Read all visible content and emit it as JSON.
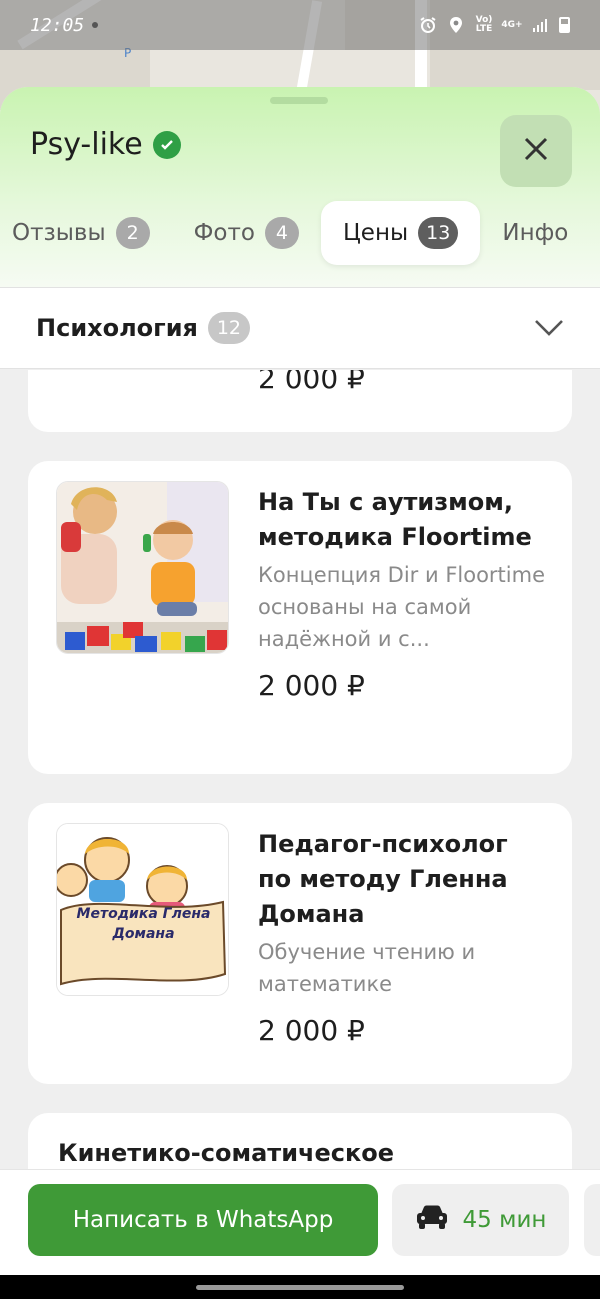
{
  "status_bar": {
    "time": "12:05",
    "network_label": "Vo) LTE",
    "signal_label": "4G+"
  },
  "map": {
    "parking_label": "P"
  },
  "sheet": {
    "title": "Psy-like",
    "tabs": [
      {
        "label": "Отзывы",
        "count": "2",
        "active": false
      },
      {
        "label": "Фото",
        "count": "4",
        "active": false
      },
      {
        "label": "Цены",
        "count": "13",
        "active": true
      },
      {
        "label": "Инфо",
        "count": null,
        "active": false
      }
    ],
    "category": {
      "title": "Психология",
      "count": "12"
    }
  },
  "cards": [
    {
      "price": "2 000 ₽"
    },
    {
      "name": "На Ты с аутизмом, методика Floortime",
      "description": "Концепция Dir и Floortime основаны на самой надёжной и с...",
      "price": "2 000 ₽"
    },
    {
      "name": "Педагог-психолог по методу Гленна Домана",
      "description": "Обучение чтению и математике",
      "image_caption": "Методика Глена Домана",
      "price": "2 000 ₽"
    },
    {
      "name": "Кинетико-соматическое"
    }
  ],
  "bottom_bar": {
    "whatsapp_label": "Написать в WhatsApp",
    "drive_time": "45 мин"
  },
  "colors": {
    "accent_green": "#3f9a37",
    "header_green": "#c9f3b1"
  }
}
